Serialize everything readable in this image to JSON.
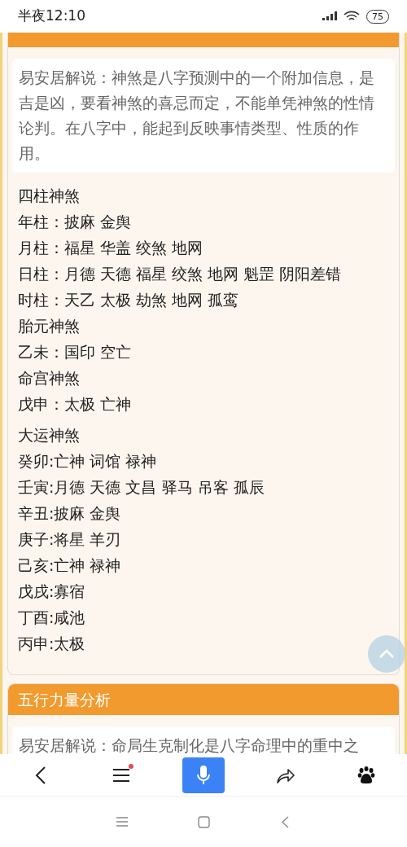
{
  "status_bar": {
    "time": "半夜12:10",
    "battery": "75"
  },
  "sections": [
    {
      "intro": "易安居解说：神煞是八字预测中的一个附加信息，是吉是凶，要看神煞的喜忌而定，不能单凭神煞的性情论判。在八字中，能起到反映事情类型、性质的作用。",
      "blocks": [
        [
          "四柱神煞",
          "年柱：披麻 金舆",
          "月柱：福星 华盖 绞煞 地网",
          "日柱：月德 天德 福星 绞煞 地网 魁罡 阴阳差错",
          "时柱：天乙 太极 劫煞 地网 孤鸾",
          "胎元神煞",
          "乙未：国印 空亡",
          "命宫神煞",
          "戊申：太极 亡神"
        ],
        [
          "大运神煞",
          "癸卯:亡神 词馆 禄神",
          "壬寅:月德 天德 文昌 驿马 吊客 孤辰",
          "辛丑:披麻 金舆",
          "庚子:将星 羊刃",
          "己亥:亡神 禄神",
          "戊戌:寡宿",
          "丁酉:咸池",
          "丙申:太极"
        ]
      ]
    },
    {
      "title": "五行力量分析",
      "intro": "易安居解说：命局生克制化是八字命理中的重中之"
    }
  ],
  "browser_toolbar": {
    "menu_notification": true
  }
}
